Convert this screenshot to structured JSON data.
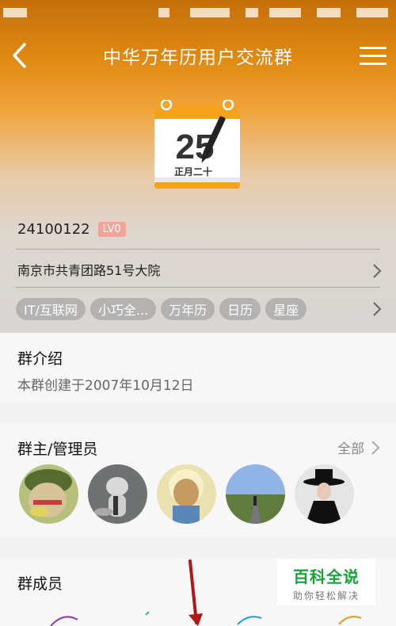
{
  "header": {
    "title": "中华万年历用户交流群"
  },
  "logo": {
    "day": "25",
    "lunar": "正月二十"
  },
  "group_info": {
    "id": "24100122",
    "level": "LV0",
    "address": "南京市共青团路51号大院",
    "tags": [
      "IT/互联网",
      "小巧全...",
      "万年历",
      "日历",
      "星座"
    ]
  },
  "intro": {
    "title": "群介绍",
    "text": "本群创建于2007年10月12日"
  },
  "admins": {
    "title": "群主/管理员",
    "more_label": "全部"
  },
  "members": {
    "title": "群成员"
  },
  "watermark": {
    "line1": "百科全说",
    "line2": "助你轻松解决"
  },
  "colors": {
    "header_orange": "#e08a12",
    "watermark_green": "#1aa23a",
    "level_badge": "#f0a59c",
    "arrow_red": "#b01818"
  },
  "icons": {
    "back": "chevron-left-icon",
    "menu": "hamburger-menu-icon",
    "chevron": "chevron-right-icon"
  }
}
